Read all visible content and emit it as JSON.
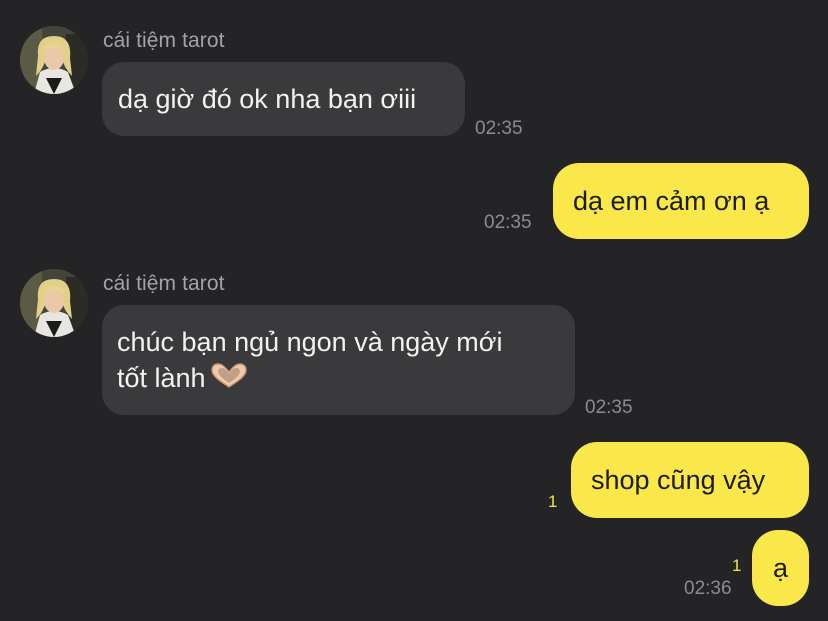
{
  "messages": [
    {
      "direction": "incoming",
      "sender": "cái tiệm tarot",
      "text": "dạ giờ đó ok nha bạn ơiii",
      "time": "02:35"
    },
    {
      "direction": "outgoing",
      "text": "dạ em cảm ơn ạ",
      "time": "02:35"
    },
    {
      "direction": "incoming",
      "sender": "cái tiệm tarot",
      "line1": "chúc bạn ngủ ngon và ngày mới",
      "line2": "tốt lành",
      "emoji": "heart-hands-emoji",
      "time": "02:35"
    },
    {
      "direction": "outgoing",
      "text": "shop cũng vậy",
      "unread": "1"
    },
    {
      "direction": "outgoing",
      "text": "ạ",
      "unread": "1",
      "time": "02:36"
    }
  ],
  "colors": {
    "background": "#242426",
    "incoming_bubble": "#3a3a3c",
    "outgoing_bubble": "#fae84a",
    "unread_count": "#f4e04a",
    "timestamp": "#8c8c90"
  }
}
